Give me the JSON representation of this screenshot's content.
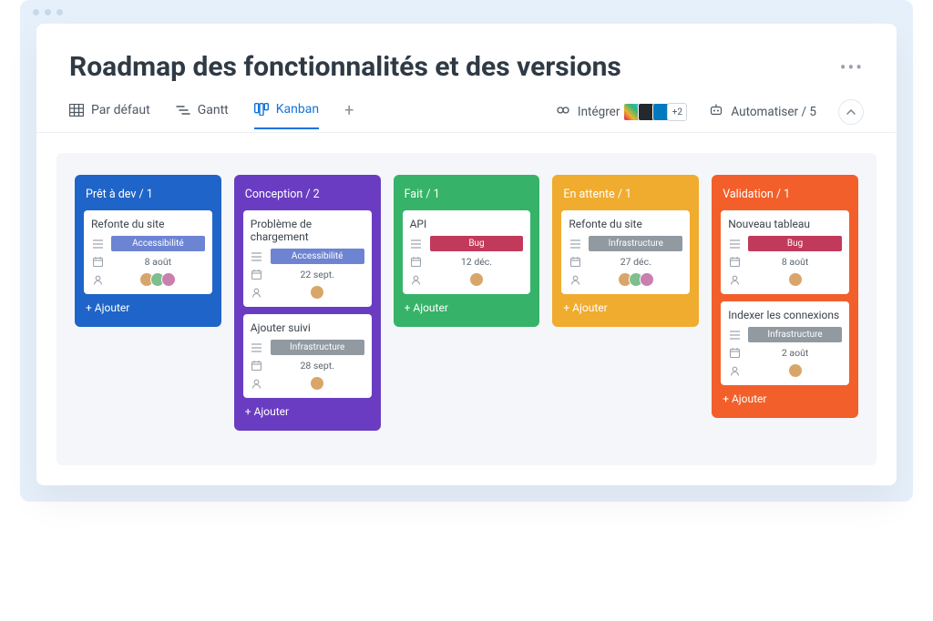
{
  "header": {
    "title": "Roadmap des fonctionnalités et des versions"
  },
  "tabs": {
    "default": "Par défaut",
    "gantt": "Gantt",
    "kanban": "Kanban"
  },
  "tools": {
    "integrate": "Intégrer",
    "integrate_more": "+2",
    "automate": "Automatiser / 5"
  },
  "add_label": "+ Ajouter",
  "tags": {
    "accessibility": {
      "label": "Accessibilité",
      "color": "#6d84d3"
    },
    "bug": {
      "label": "Bug",
      "color": "#c23a5b"
    },
    "infrastructure": {
      "label": "Infrastructure",
      "color": "#9199a1"
    }
  },
  "avatar_colors": [
    "#d9a66a",
    "#7fbf8e",
    "#c97fb0",
    "#6a9bd9",
    "#d98d6a"
  ],
  "columns": [
    {
      "id": "ready",
      "title": "Prêt à dev / 1",
      "color": "#1f64c8",
      "cards": [
        {
          "title": "Refonte du site",
          "tag": "accessibility",
          "date": "8 août",
          "avatars": 3
        }
      ]
    },
    {
      "id": "design",
      "title": "Conception / 2",
      "color": "#6a3cc2",
      "cards": [
        {
          "title": "Problème de chargement",
          "tag": "accessibility",
          "date": "22 sept.",
          "avatars": 1
        },
        {
          "title": "Ajouter suivi",
          "tag": "infrastructure",
          "date": "28 sept.",
          "avatars": 1
        }
      ]
    },
    {
      "id": "done",
      "title": "Fait / 1",
      "color": "#36b368",
      "cards": [
        {
          "title": "API",
          "tag": "bug",
          "date": "12 déc.",
          "avatars": 1
        }
      ]
    },
    {
      "id": "waiting",
      "title": "En attente / 1",
      "color": "#f0ac2f",
      "cards": [
        {
          "title": "Refonte du site",
          "tag": "infrastructure",
          "date": "27 déc.",
          "avatars": 3
        }
      ]
    },
    {
      "id": "validation",
      "title": "Validation / 1",
      "color": "#f25f2a",
      "cards": [
        {
          "title": "Nouveau tableau",
          "tag": "bug",
          "date": "8 août",
          "avatars": 1
        },
        {
          "title": "Indexer les connexions",
          "tag": "infrastructure",
          "date": "2 août",
          "avatars": 1
        }
      ]
    }
  ]
}
